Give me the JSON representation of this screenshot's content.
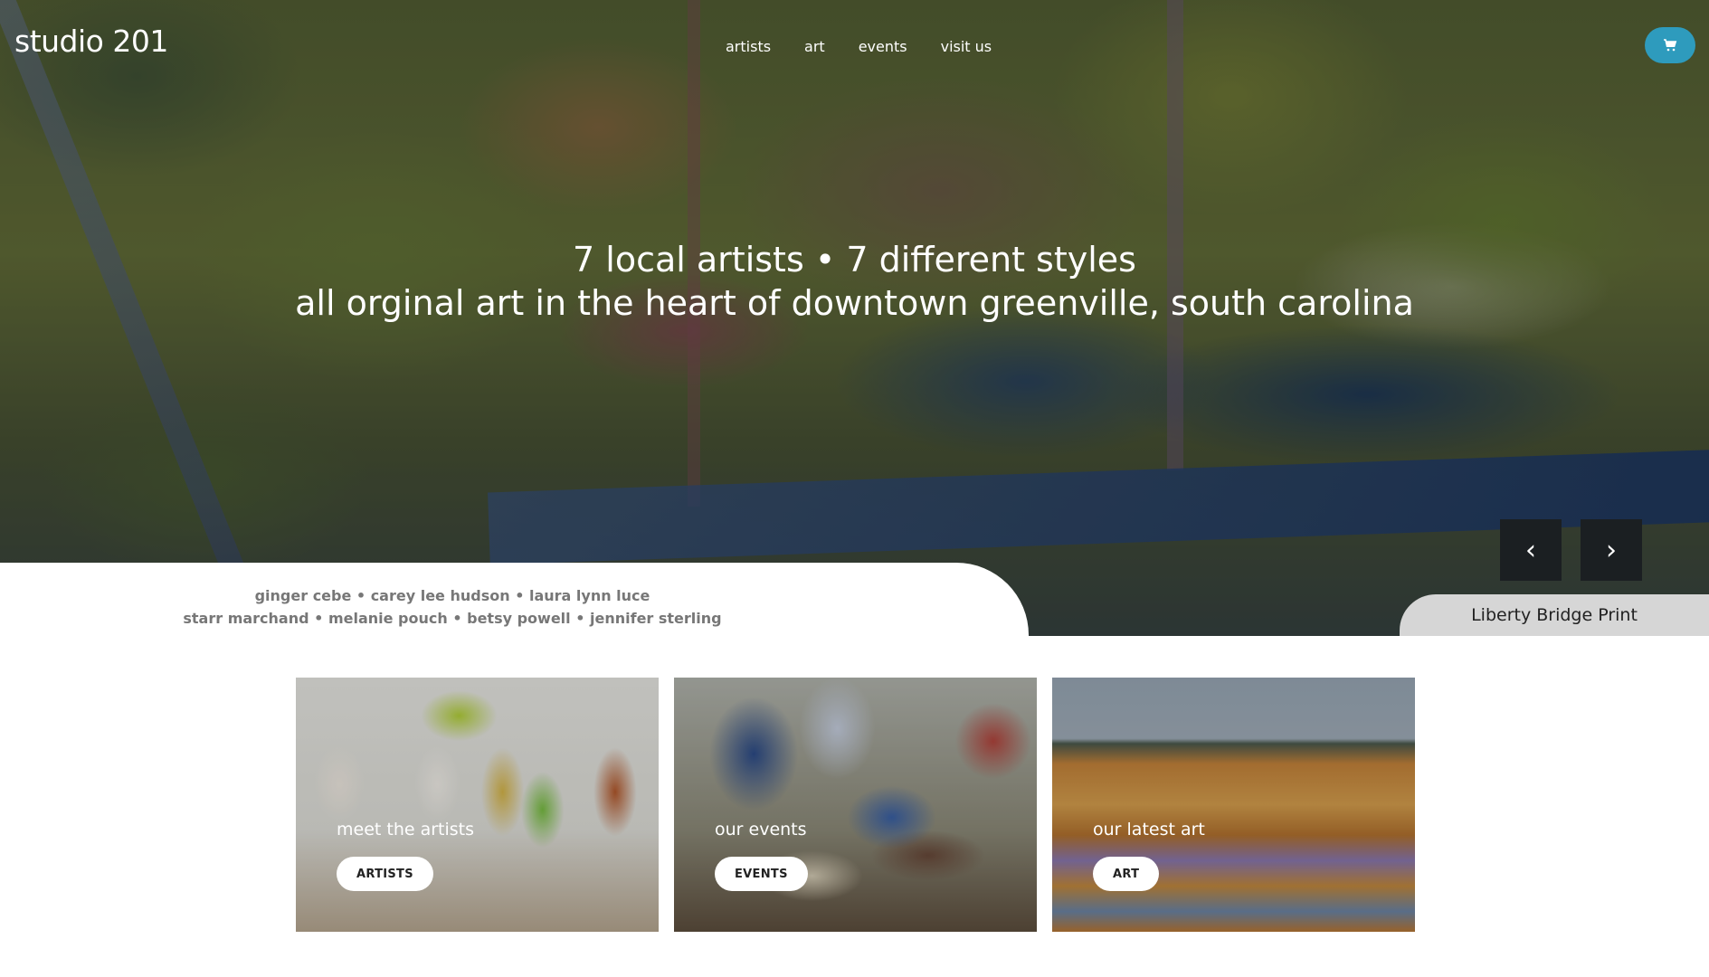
{
  "header": {
    "logo": "studio 201",
    "nav": [
      "artists",
      "art",
      "events",
      "visit us"
    ],
    "cart_icon": "cart-icon",
    "cart_color": "#2e9bbd"
  },
  "hero": {
    "headline_line1": "7 local artists • 7 different styles",
    "headline_line2": "all orginal art in the heart of downtown greenville, south carolina",
    "prev_label": "‹",
    "next_label": "›",
    "caption": "Liberty Bridge Print"
  },
  "artists_list": {
    "line1": "ginger cebe • carey lee hudson • laura lynn luce",
    "line2": "starr marchand • melanie pouch • betsy powell • jennifer sterling"
  },
  "cards": [
    {
      "title": "meet the artists",
      "button": "ARTISTS"
    },
    {
      "title": "our events",
      "button": "EVENTS"
    },
    {
      "title": "our latest art",
      "button": "ART"
    }
  ]
}
